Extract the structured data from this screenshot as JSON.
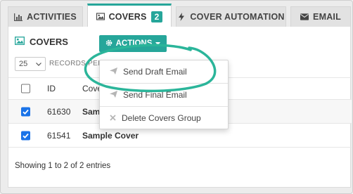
{
  "colors": {
    "accent": "#26a69a",
    "checkbox": "#1a73e8"
  },
  "tabs": [
    {
      "label": "ACTIVITIES",
      "icon": "bar-chart-icon"
    },
    {
      "label": "COVERS",
      "icon": "image-icon",
      "badge": "2",
      "active": true
    },
    {
      "label": "COVER AUTOMATION",
      "icon": "bolt-icon"
    },
    {
      "label": "EMAIL",
      "icon": "envelope-icon"
    }
  ],
  "panel": {
    "title": "COVERS",
    "actions_label": "ACTIONS",
    "page_length": "25",
    "records_label": "RECORDS PER"
  },
  "table": {
    "headers": {
      "id": "ID",
      "cover": "Cove"
    },
    "rows": [
      {
        "id": "61630",
        "name": "Sam",
        "checked": true
      },
      {
        "id": "61541",
        "name": "Sample Cover",
        "checked": true
      }
    ]
  },
  "footer": {
    "info": "Showing 1 to 2 of 2 entries"
  },
  "actions_menu": [
    {
      "label": "Send Draft Email",
      "icon": "paper-plane-icon"
    },
    {
      "label": "Send Final Email",
      "icon": "paper-plane-icon"
    },
    {
      "label": "Delete Covers Group",
      "icon": "close-icon"
    }
  ]
}
